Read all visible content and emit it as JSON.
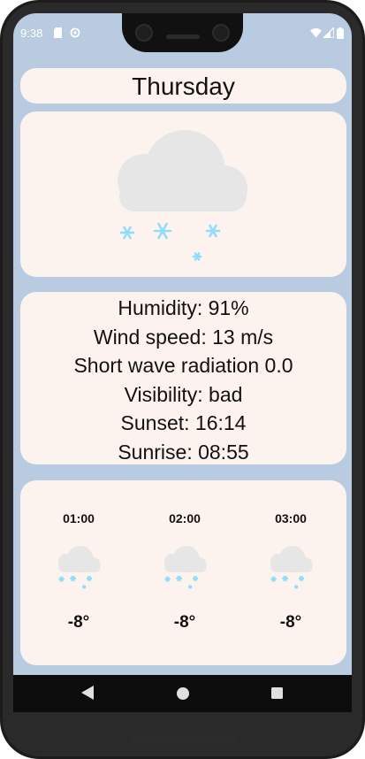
{
  "status_bar": {
    "time": "9:38"
  },
  "day": {
    "title": "Thursday"
  },
  "main_icon": "cloud-snow-icon",
  "details": {
    "humidity": "Humidity: 91%",
    "wind_speed": "Wind speed: 13 m/s",
    "short_wave_radiation": "Short wave radiation 0.0",
    "visibility": "Visibility: bad",
    "sunset": "Sunset: 16:14",
    "sunrise": "Sunrise: 08:55"
  },
  "hourly": [
    {
      "time": "01:00",
      "icon": "cloud-snow-icon",
      "temp": "-8°"
    },
    {
      "time": "02:00",
      "icon": "cloud-snow-icon",
      "temp": "-8°"
    },
    {
      "time": "03:00",
      "icon": "cloud-snow-icon",
      "temp": "-8°"
    }
  ],
  "colors": {
    "background": "#b8cbe0",
    "card": "#fdf3ee",
    "cloud": "#e6e6e6",
    "snow": "#8fdcfb"
  }
}
